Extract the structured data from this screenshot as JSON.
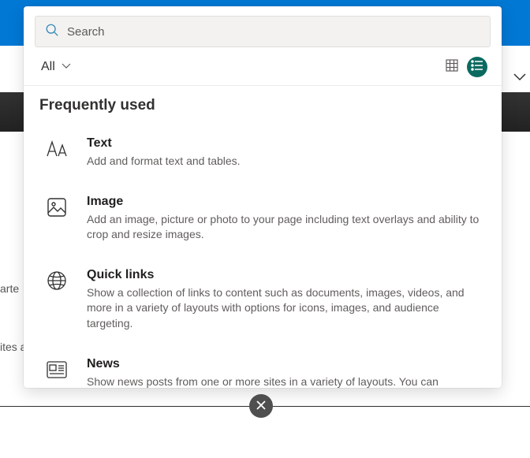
{
  "search": {
    "placeholder": "Search"
  },
  "filter": {
    "label": "All"
  },
  "section": {
    "title": "Frequently used"
  },
  "items": [
    {
      "title": "Text",
      "desc": "Add and format text and tables."
    },
    {
      "title": "Image",
      "desc": "Add an image, picture or photo to your page including text overlays and ability to crop and resize images."
    },
    {
      "title": "Quick links",
      "desc": "Show a collection of links to content such as documents, images, videos, and more in a variety of layouts with options for icons, images, and audience targeting."
    },
    {
      "title": "News",
      "desc": "Show news posts from one or more sites in a variety of layouts. You can"
    }
  ],
  "bg": {
    "text1": "arte",
    "text2": "ites a"
  }
}
